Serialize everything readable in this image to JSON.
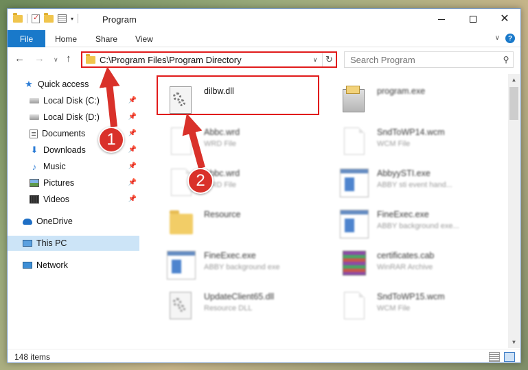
{
  "window": {
    "title": "Program",
    "minimize_label": "",
    "maximize_label": "",
    "close_label": "✕"
  },
  "ribbon": {
    "file": "File",
    "home": "Home",
    "share": "Share",
    "view": "View"
  },
  "address": {
    "path": "C:\\Program Files\\Program Directory"
  },
  "search": {
    "placeholder": "Search Program"
  },
  "sidebar": {
    "items": [
      {
        "label": "Quick access",
        "icon": "star-icon"
      },
      {
        "label": "Local Disk (C:)",
        "icon": "drive-icon"
      },
      {
        "label": "Local Disk (D:)",
        "icon": "drive-icon"
      },
      {
        "label": "Documents",
        "icon": "documents-icon"
      },
      {
        "label": "Downloads",
        "icon": "download-icon"
      },
      {
        "label": "Music",
        "icon": "music-icon"
      },
      {
        "label": "Pictures",
        "icon": "pictures-icon"
      },
      {
        "label": "Videos",
        "icon": "videos-icon"
      },
      {
        "label": "OneDrive",
        "icon": "cloud-icon"
      },
      {
        "label": "This PC",
        "icon": "computer-icon"
      },
      {
        "label": "Network",
        "icon": "network-icon"
      }
    ]
  },
  "files": [
    {
      "name": "dilbw.dll",
      "type": ""
    },
    {
      "name": "program.exe",
      "type": ""
    },
    {
      "name": "Abbc.wrd",
      "type": "WRD File"
    },
    {
      "name": "SndToWP14.wcm",
      "type": "WCM File"
    },
    {
      "name": "Abbc.wrd",
      "type": "WRD File"
    },
    {
      "name": "AbbyySTI.exe",
      "type": "ABBY sti event hand..."
    },
    {
      "name": "Resource",
      "type": ""
    },
    {
      "name": "FineExec.exe",
      "type": "ABBY background exe..."
    },
    {
      "name": "FineExec.exe",
      "type": "ABBY background exe"
    },
    {
      "name": "certificates.cab",
      "type": "WinRAR Archive"
    },
    {
      "name": "UpdateClient65.dll",
      "type": "Resource DLL"
    },
    {
      "name": "SndToWP15.wcm",
      "type": "WCM File"
    }
  ],
  "markers": {
    "one": "1",
    "two": "2"
  },
  "status": {
    "items": "148 items"
  },
  "colors": {
    "accent": "#1979ca",
    "highlight": "#e11a1a",
    "marker": "#d9312a"
  }
}
